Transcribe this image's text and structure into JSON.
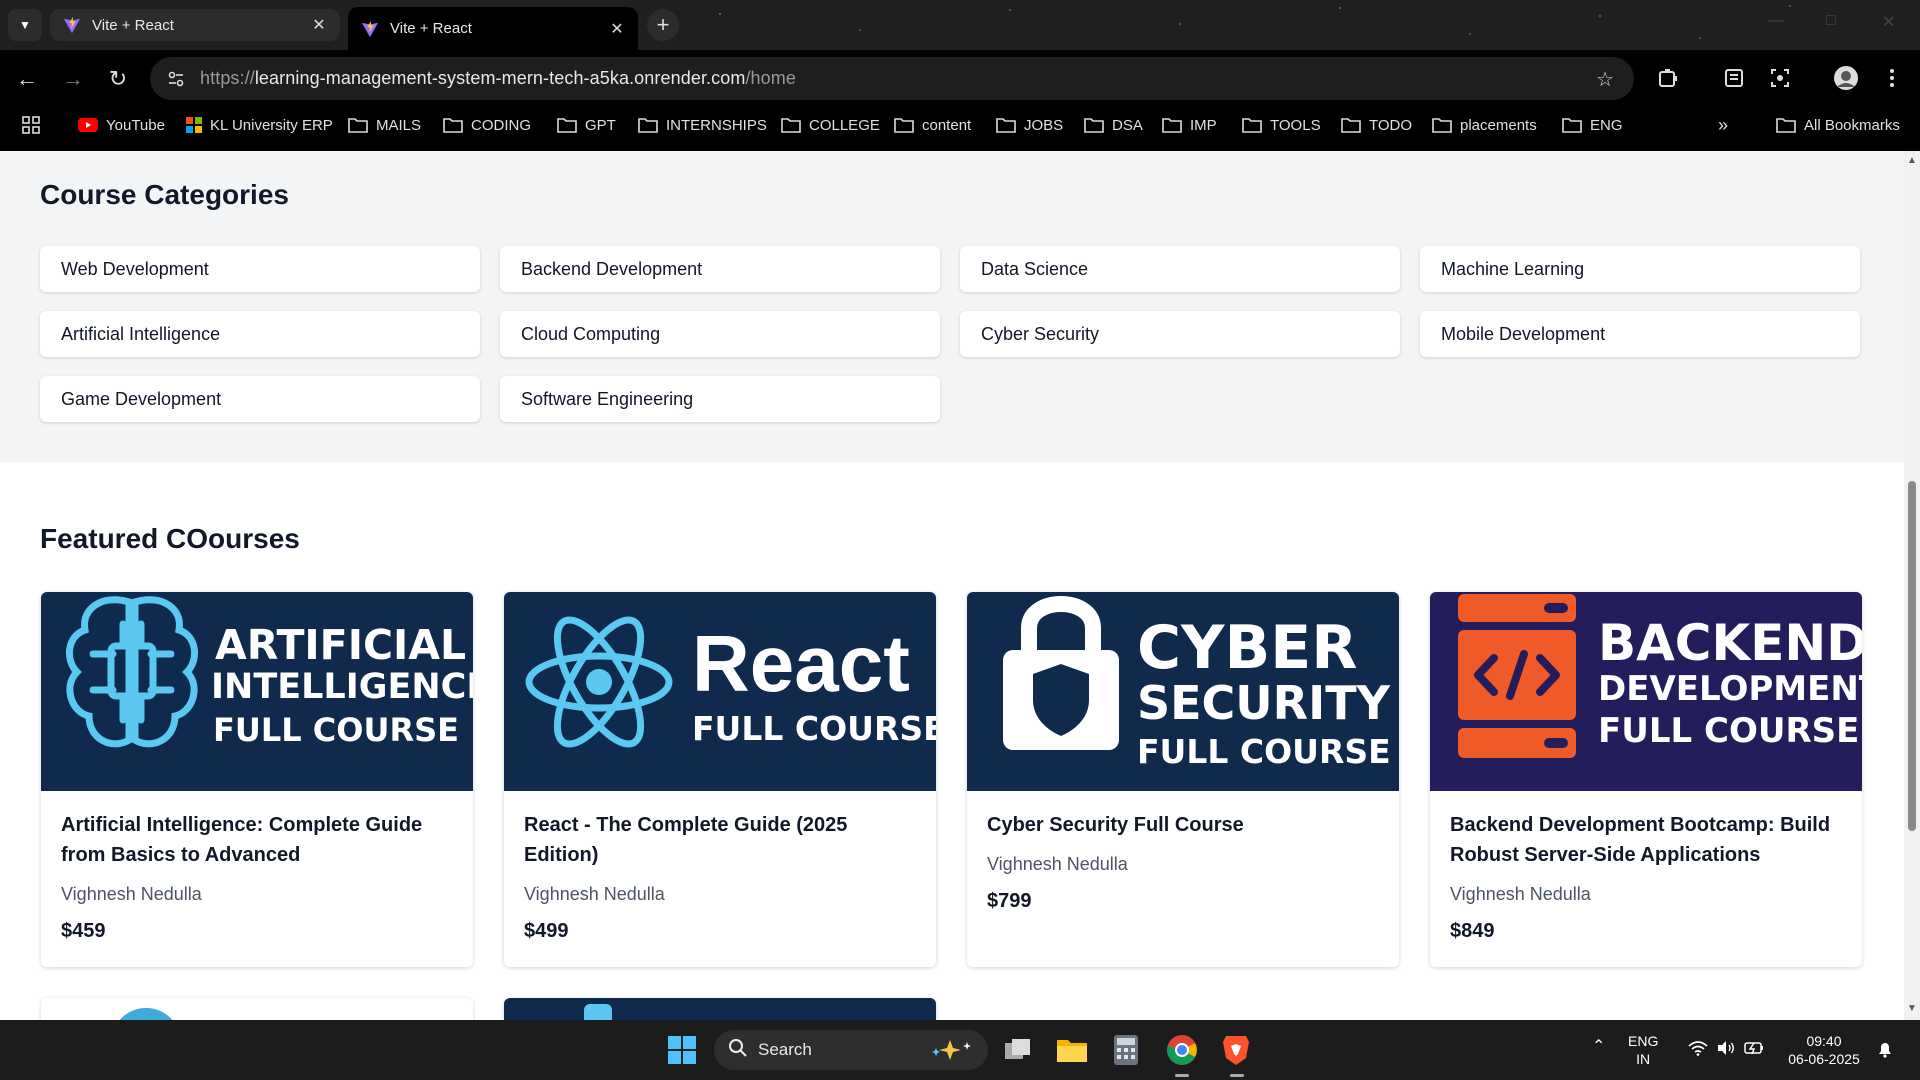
{
  "browser": {
    "tabs": [
      {
        "title": "Vite + React",
        "active": false
      },
      {
        "title": "Vite + React",
        "active": true
      }
    ],
    "url": {
      "scheme": "https://",
      "host": "learning-management-system-mern-tech-a5ka.onrender.com",
      "path": "/home"
    },
    "bookmarks": [
      {
        "label": "YouTube",
        "icon": "youtube-icon"
      },
      {
        "label": "KL University ERP",
        "icon": "windows-logo-icon"
      },
      {
        "label": "MAILS",
        "icon": "folder-icon"
      },
      {
        "label": "CODING",
        "icon": "folder-icon"
      },
      {
        "label": "GPT",
        "icon": "folder-icon"
      },
      {
        "label": "INTERNSHIPS",
        "icon": "folder-icon"
      },
      {
        "label": "COLLEGE",
        "icon": "folder-icon"
      },
      {
        "label": "content",
        "icon": "folder-icon"
      },
      {
        "label": "JOBS",
        "icon": "folder-icon"
      },
      {
        "label": "DSA",
        "icon": "folder-icon"
      },
      {
        "label": "IMP",
        "icon": "folder-icon"
      },
      {
        "label": "TOOLS",
        "icon": "folder-icon"
      },
      {
        "label": "TODO",
        "icon": "folder-icon"
      },
      {
        "label": "placements",
        "icon": "folder-icon"
      },
      {
        "label": "ENG",
        "icon": "folder-icon"
      }
    ],
    "all_bookmarks_label": "All Bookmarks"
  },
  "categories": {
    "title": "Course Categories",
    "items": [
      "Web Development",
      "Backend Development",
      "Data Science",
      "Machine Learning",
      "Artificial Intelligence",
      "Cloud Computing",
      "Cyber Security",
      "Mobile Development",
      "Game Development",
      "Software Engineering"
    ]
  },
  "featured": {
    "title": "Featured COourses",
    "courses": [
      {
        "title": "Artificial Intelligence: Complete Guide from Basics to Advanced",
        "author": "Vighnesh Nedulla",
        "price": "$459",
        "thumb": {
          "line1": "ARTIFICIAL",
          "line2": "INTELLIGENCE",
          "line3": "FULL COURSE",
          "icon": "brain-chip-icon"
        }
      },
      {
        "title": "React - The Complete Guide (2025 Edition)",
        "author": "Vighnesh Nedulla",
        "price": "$499",
        "thumb": {
          "line1": "React",
          "line2": "FULL COURSE",
          "icon": "react-atom-icon"
        }
      },
      {
        "title": "Cyber Security Full Course",
        "author": "Vighnesh Nedulla",
        "price": "$799",
        "thumb": {
          "line1": "CYBER",
          "line2": "SECURITY",
          "line3": "FULL COURSE",
          "icon": "padlock-shield-icon"
        }
      },
      {
        "title": "Backend Development Bootcamp: Build Robust Server-Side Applications",
        "author": "Vighnesh Nedulla",
        "price": "$849",
        "thumb": {
          "line1": "BACKEND",
          "line2": "DEVELOPMENT",
          "line3": "FULL COURSE",
          "icon": "server-code-icon"
        }
      }
    ]
  },
  "taskbar": {
    "search_label": "Search",
    "lang_line1": "ENG",
    "lang_line2": "IN",
    "time": "09:40",
    "date": "06-06-2025"
  },
  "colors": {
    "thumb_bg": "#0f2a4d",
    "backend_thumb_bg": "#231d5c",
    "accent_cyan": "#5ac8f0",
    "accent_orange": "#f05a28",
    "page_gray": "#f3f4f6"
  }
}
